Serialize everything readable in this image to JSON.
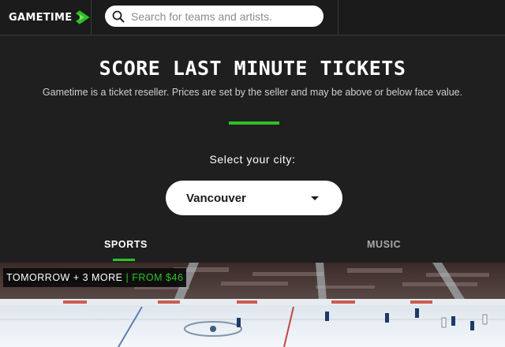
{
  "header": {
    "logo_text": "GAMETIME",
    "search": {
      "placeholder": "Search for teams and artists."
    }
  },
  "hero": {
    "headline": "SCORE LAST MINUTE TICKETS",
    "disclaimer": "Gametime is a ticket reseller. Prices are set by the seller and may be above or below face value.",
    "city_label": "Select your city:",
    "city_selected": "Vancouver"
  },
  "tabs": [
    {
      "label": "SPORTS",
      "active": true
    },
    {
      "label": "MUSIC",
      "active": false
    }
  ],
  "event": {
    "when": "TOMORROW + 3 MORE",
    "separator": "|",
    "price": "FROM $46"
  },
  "colors": {
    "accent": "#2ec026",
    "background": "#1f1f1f",
    "header": "#1b1b1b"
  },
  "icons": [
    "gametime-logo-icon",
    "search-icon",
    "chevron-down-icon"
  ]
}
